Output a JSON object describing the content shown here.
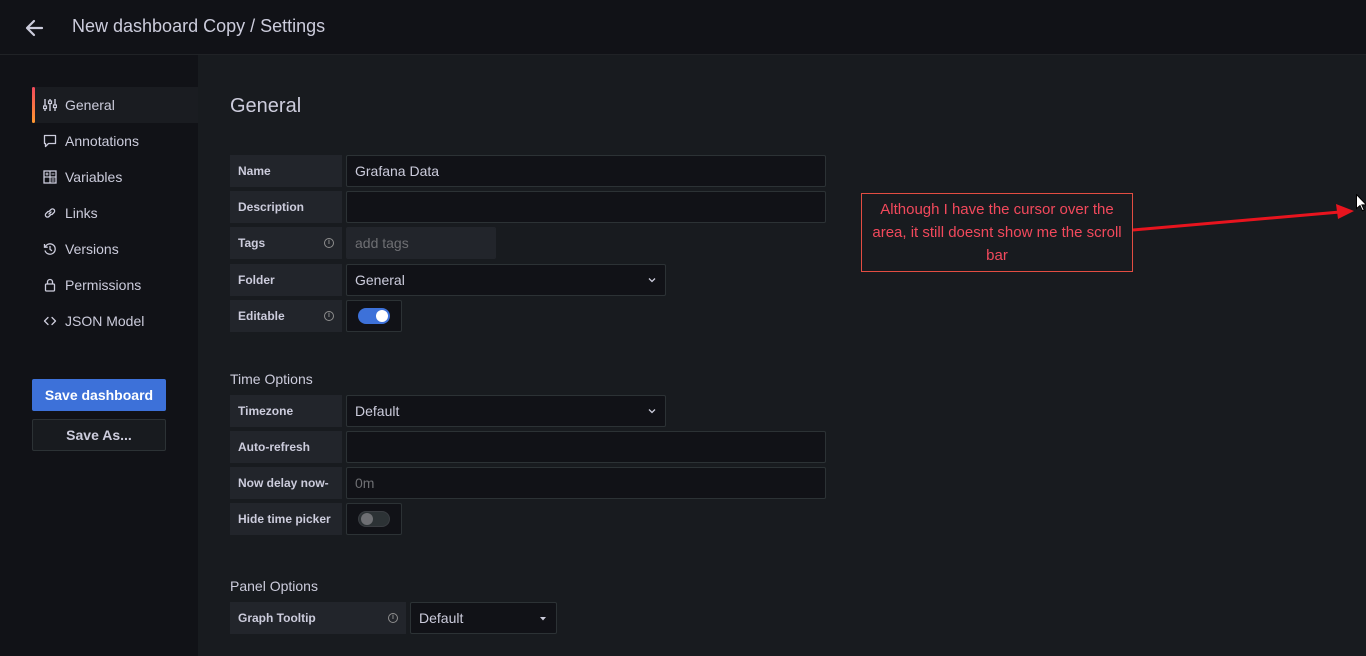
{
  "header": {
    "title": "New dashboard Copy / Settings",
    "back_icon": "arrow-left-icon"
  },
  "sidebar": {
    "items": [
      {
        "label": "General",
        "icon": "sliders-icon",
        "active": true
      },
      {
        "label": "Annotations",
        "icon": "comment-icon"
      },
      {
        "label": "Variables",
        "icon": "calculator-icon"
      },
      {
        "label": "Links",
        "icon": "link-icon"
      },
      {
        "label": "Versions",
        "icon": "history-icon"
      },
      {
        "label": "Permissions",
        "icon": "lock-icon"
      },
      {
        "label": "JSON Model",
        "icon": "code-icon"
      }
    ],
    "save_label": "Save dashboard",
    "save_as_label": "Save As..."
  },
  "main": {
    "heading": "General",
    "general": {
      "name_label": "Name",
      "name_value": "Grafana Data",
      "description_label": "Description",
      "description_value": "",
      "tags_label": "Tags",
      "tags_placeholder": "add tags",
      "folder_label": "Folder",
      "folder_value": "General",
      "editable_label": "Editable",
      "editable_on": true
    },
    "time_options": {
      "title": "Time Options",
      "timezone_label": "Timezone",
      "timezone_value": "Default",
      "autorefresh_label": "Auto-refresh",
      "autorefresh_value": "",
      "nowdelay_label": "Now delay now-",
      "nowdelay_placeholder": "0m",
      "hidetimepicker_label": "Hide time picker",
      "hidetimepicker_on": false
    },
    "panel_options": {
      "title": "Panel Options",
      "graph_tooltip_label": "Graph Tooltip",
      "graph_tooltip_value": "Default"
    }
  },
  "annotation": {
    "text": "Although I have the cursor over the area, it still doesnt show me the scroll bar",
    "color": "#e24d42"
  },
  "colors": {
    "accent": "#3d71d9",
    "background": "#111217",
    "panel": "#181b1f"
  }
}
